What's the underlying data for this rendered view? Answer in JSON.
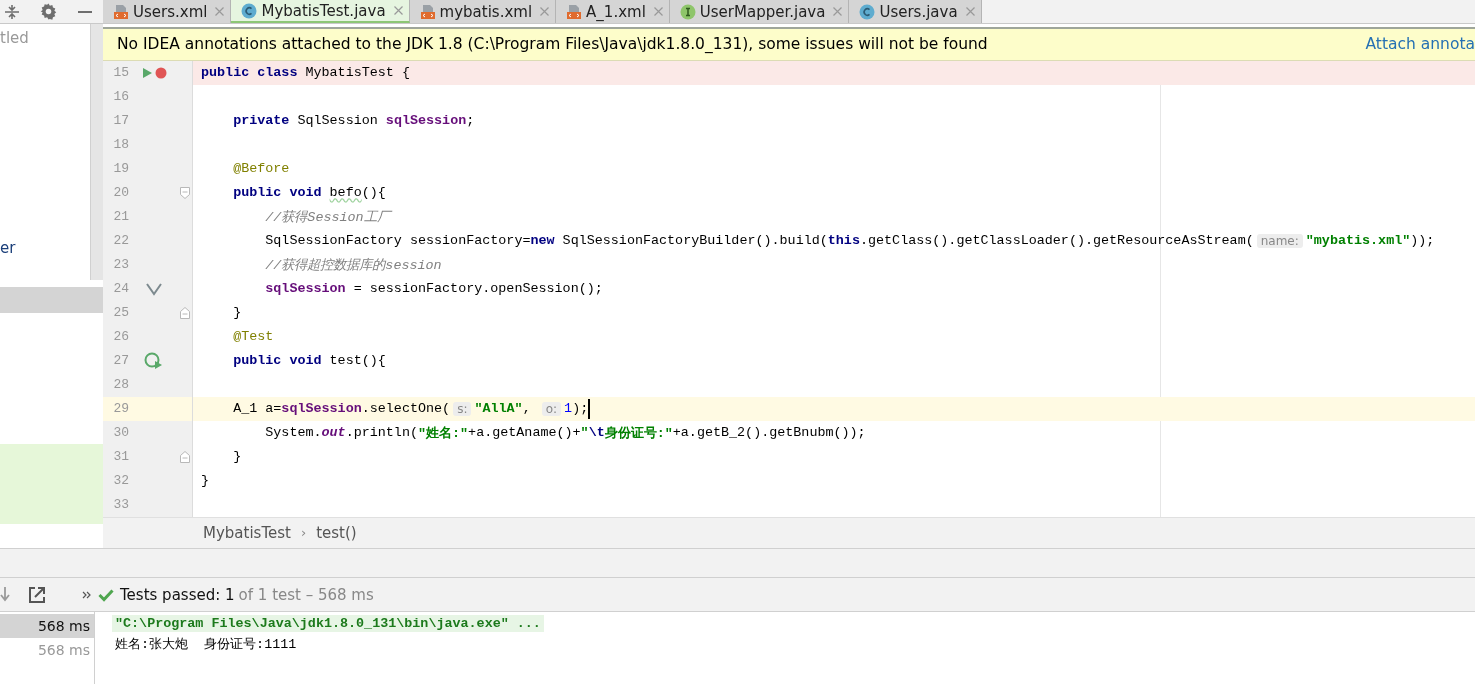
{
  "tabs": [
    {
      "label": "Users.xml",
      "kind": "xml",
      "selected": false
    },
    {
      "label": "MybatisTest.java",
      "kind": "class",
      "selected": true
    },
    {
      "label": "mybatis.xml",
      "kind": "xml",
      "selected": false
    },
    {
      "label": "A_1.xml",
      "kind": "xml",
      "selected": false
    },
    {
      "label": "UserMapper.java",
      "kind": "interface",
      "selected": false
    },
    {
      "label": "Users.java",
      "kind": "class",
      "selected": false
    }
  ],
  "project": {
    "items": [
      {
        "label": "tled",
        "selected": false
      },
      {
        "label": "er",
        "selected": false
      }
    ]
  },
  "banner": {
    "message": "No IDEA annotations attached to the JDK 1.8 (C:\\Program Files\\Java\\jdk1.8.0_131), some issues will not be found",
    "link": "Attach annota"
  },
  "editor": {
    "lines": [
      {
        "number": "15",
        "error": true,
        "run_marker": true,
        "breakpoint": true,
        "tokens": [
          {
            "kind": "kw",
            "text": "public class"
          },
          {
            "kind": "plain",
            "text": " MybatisTest {"
          }
        ]
      },
      {
        "number": "16"
      },
      {
        "number": "17",
        "tokens": [
          {
            "kind": "kw",
            "text": "    private"
          },
          {
            "kind": "plain",
            "text": " SqlSession "
          },
          {
            "kind": "field",
            "text": "sqlSession"
          },
          {
            "kind": "plain",
            "text": ";"
          }
        ]
      },
      {
        "number": "18"
      },
      {
        "number": "19",
        "tokens": [
          {
            "kind": "annot",
            "text": "    @Before"
          }
        ]
      },
      {
        "number": "20",
        "fold_start": true,
        "tokens": [
          {
            "kind": "kw",
            "text": "    public void "
          },
          {
            "kind": "warn",
            "text": "befo"
          },
          {
            "kind": "plain",
            "text": "(){"
          }
        ]
      },
      {
        "number": "21",
        "tokens": [
          {
            "kind": "comment",
            "text": "        //获得Session工厂"
          }
        ]
      },
      {
        "number": "22",
        "tokens": [
          {
            "kind": "plain",
            "text": "        SqlSessionFactory sessionFactory="
          },
          {
            "kind": "kw",
            "text": "new"
          },
          {
            "kind": "plain",
            "text": " SqlSessionFactoryBuilder().build("
          },
          {
            "kind": "kw",
            "text": "this"
          },
          {
            "kind": "plain",
            "text": ".getClass().getClassLoader().getResourceAsStream("
          },
          {
            "kind": "hint",
            "text": "name:"
          },
          {
            "kind": "string",
            "text": "\"mybatis.xml\""
          },
          {
            "kind": "plain",
            "text": "));"
          }
        ]
      },
      {
        "number": "23",
        "tokens": [
          {
            "kind": "comment",
            "text": "        //获得超控数据库的session"
          }
        ]
      },
      {
        "number": "24",
        "check_mark": true,
        "tokens": [
          {
            "kind": "field",
            "text": "        sqlSession"
          },
          {
            "kind": "plain",
            "text": " = sessionFactory.openSession();"
          }
        ]
      },
      {
        "number": "25",
        "fold_end": true,
        "tokens": [
          {
            "kind": "plain",
            "text": "    }"
          }
        ]
      },
      {
        "number": "26",
        "tokens": [
          {
            "kind": "annot",
            "text": "    @Test"
          }
        ]
      },
      {
        "number": "27",
        "test_run": true,
        "tokens": [
          {
            "kind": "kw",
            "text": "    public void"
          },
          {
            "kind": "plain",
            "text": " test(){"
          }
        ]
      },
      {
        "number": "28"
      },
      {
        "number": "29",
        "current": true,
        "caret": true,
        "tokens": [
          {
            "kind": "plain",
            "text": "    A_1 a="
          },
          {
            "kind": "field",
            "text": "sqlSession"
          },
          {
            "kind": "plain",
            "text": ".selectOne("
          },
          {
            "kind": "hint",
            "text": "s:"
          },
          {
            "kind": "string",
            "text": "\"AllA\""
          },
          {
            "kind": "plain",
            "text": ", "
          },
          {
            "kind": "hint",
            "text": "o:"
          },
          {
            "kind": "number",
            "text": "1"
          },
          {
            "kind": "plain",
            "text": ");"
          }
        ]
      },
      {
        "number": "30",
        "tokens": [
          {
            "kind": "plain",
            "text": "        System."
          },
          {
            "kind": "static",
            "text": "out"
          },
          {
            "kind": "plain",
            "text": ".println("
          },
          {
            "kind": "string",
            "text": "\"姓名:\""
          },
          {
            "kind": "plain",
            "text": "+a.getAname()+"
          },
          {
            "kind": "string",
            "text": "\""
          },
          {
            "kind": "escape",
            "text": "\\t"
          },
          {
            "kind": "string",
            "text": "身份证号:\""
          },
          {
            "kind": "plain",
            "text": "+a.getB_2().getBnubm());"
          }
        ]
      },
      {
        "number": "31",
        "fold_end": true,
        "tokens": [
          {
            "kind": "plain",
            "text": "    }"
          }
        ]
      },
      {
        "number": "32",
        "tokens": [
          {
            "kind": "plain",
            "text": "}"
          }
        ]
      },
      {
        "number": "33"
      }
    ]
  },
  "breadcrumbs": [
    "MybatisTest",
    "›",
    "test()"
  ],
  "run": {
    "status": "Tests passed: 1",
    "summary": "of 1 test – 568 ms",
    "tree": [
      {
        "time": "568 ms",
        "selected": true
      },
      {
        "time": "568 ms",
        "selected": false
      }
    ],
    "console": [
      {
        "kind": "command",
        "text": "\"C:\\Program Files\\Java\\jdk1.8.0_131\\bin\\java.exe\" ..."
      },
      {
        "kind": "output",
        "text": "姓名:张大炮  身份证号:1111"
      }
    ]
  }
}
